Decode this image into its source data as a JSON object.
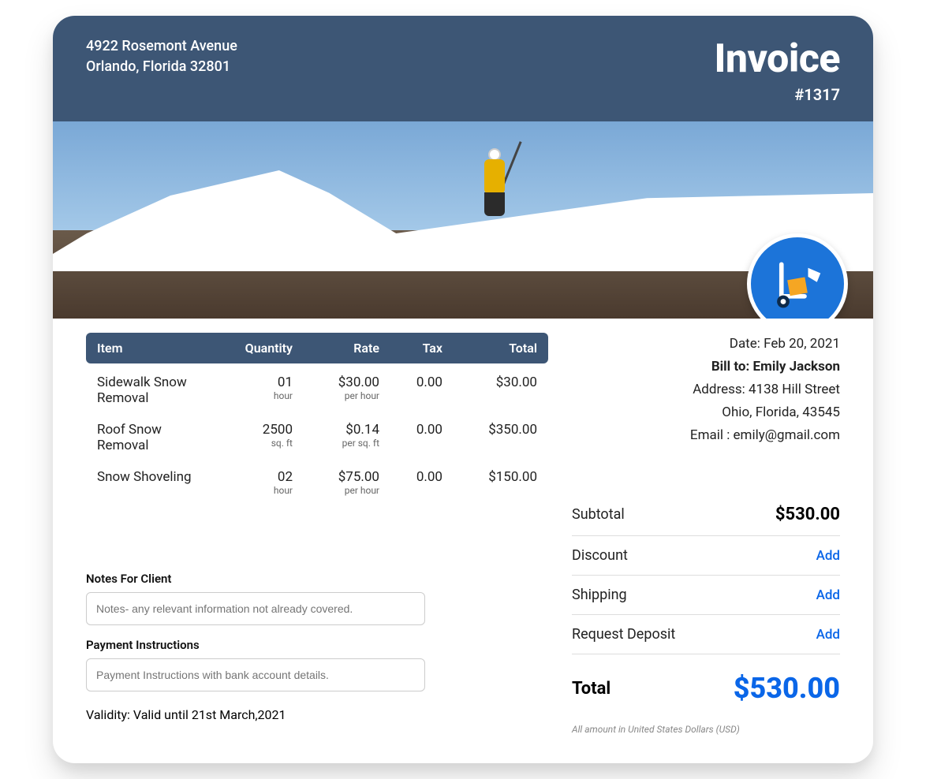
{
  "header": {
    "address_line1": "4922 Rosemont Avenue",
    "address_line2": "Orlando, Florida 32801",
    "title": "Invoice",
    "number": "#1317"
  },
  "badge_icon": "hand-truck-icon",
  "columns": {
    "item": "Item",
    "quantity": "Quantity",
    "rate": "Rate",
    "tax": "Tax",
    "total": "Total"
  },
  "items": [
    {
      "name": "Sidewalk Snow Removal",
      "qty": "01",
      "qty_unit": "hour",
      "rate": "$30.00",
      "rate_unit": "per hour",
      "tax": "0.00",
      "total": "$30.00"
    },
    {
      "name": "Roof Snow Removal",
      "qty": "2500",
      "qty_unit": "sq. ft",
      "rate": "$0.14",
      "rate_unit": "per sq. ft",
      "tax": "0.00",
      "total": "$350.00"
    },
    {
      "name": "Snow Shoveling",
      "qty": "02",
      "qty_unit": "hour",
      "rate": "$75.00",
      "rate_unit": "per hour",
      "tax": "0.00",
      "total": "$150.00"
    }
  ],
  "billto": {
    "date_label": "Date: ",
    "date": "Feb 20, 2021",
    "bill_label": "Bill to: ",
    "name": "Emily Jackson",
    "address_label": "Address: ",
    "address1": "4138 Hill Street",
    "address2": "Ohio, Florida, 43545",
    "email_label": "Email : ",
    "email": "emily@gmail.com"
  },
  "totals": {
    "subtotal_label": "Subtotal",
    "subtotal": "$530.00",
    "discount_label": "Discount",
    "shipping_label": "Shipping",
    "deposit_label": "Request Deposit",
    "add": "Add",
    "total_label": "Total",
    "total": "$530.00",
    "note": "All amount in United States Dollars (USD)"
  },
  "notes": {
    "notes_label": "Notes For Client",
    "notes_placeholder": "Notes- any relevant information not already covered.",
    "pay_label": "Payment Instructions",
    "pay_placeholder": "Payment Instructions with bank account details.",
    "validity_label": "Validity: ",
    "validity": "Valid until 21st March,2021"
  }
}
